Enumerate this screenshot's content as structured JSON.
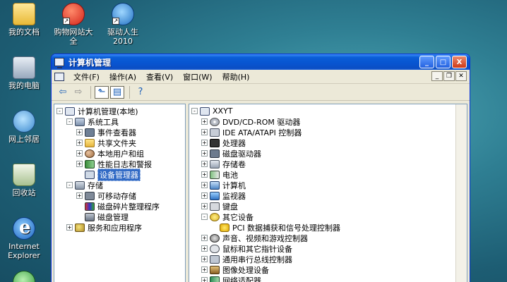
{
  "desktop": {
    "icons": [
      {
        "label": "我的文档",
        "icon": "my-documents-icon"
      },
      {
        "label": "购物网站大全",
        "icon": "shopping-sites-icon",
        "shortcut": true
      },
      {
        "label": "驱动人生2010",
        "icon": "driver-life-icon",
        "shortcut": true
      },
      {
        "label": "我的电脑",
        "icon": "my-computer-icon"
      },
      {
        "label": "网上邻居",
        "icon": "network-places-icon"
      },
      {
        "label": "回收站",
        "icon": "recycle-bin-icon"
      },
      {
        "label": "Internet Explorer",
        "icon": "internet-explorer-icon"
      }
    ]
  },
  "window": {
    "title": "计算机管理",
    "buttons": {
      "minimize": "_",
      "maximize": "□",
      "close": "X"
    },
    "menu": [
      "文件(F)",
      "操作(A)",
      "查看(V)",
      "窗口(W)",
      "帮助(H)"
    ],
    "mdi_buttons": {
      "minimize": "_",
      "restore": "❐",
      "close": "✕"
    }
  },
  "toolbar": {
    "back": "⇦",
    "forward": "⇨",
    "up": "⬑",
    "show_hide": "▤",
    "help": "?"
  },
  "left_tree": [
    {
      "label": "计算机管理(本地)",
      "indent": 0,
      "expander": "-",
      "icon": "computer-management-icon"
    },
    {
      "label": "系统工具",
      "indent": 1,
      "expander": "-",
      "icon": "system-tools-icon"
    },
    {
      "label": "事件查看器",
      "indent": 2,
      "expander": "+",
      "icon": "event-viewer-icon"
    },
    {
      "label": "共享文件夹",
      "indent": 2,
      "expander": "+",
      "icon": "shared-folders-icon"
    },
    {
      "label": "本地用户和组",
      "indent": 2,
      "expander": "+",
      "icon": "local-users-icon"
    },
    {
      "label": "性能日志和警报",
      "indent": 2,
      "expander": "+",
      "icon": "performance-logs-icon"
    },
    {
      "label": "设备管理器",
      "indent": 2,
      "expander": "",
      "icon": "device-manager-icon",
      "selected": true
    },
    {
      "label": "存储",
      "indent": 1,
      "expander": "-",
      "icon": "storage-icon"
    },
    {
      "label": "可移动存储",
      "indent": 2,
      "expander": "+",
      "icon": "removable-storage-icon"
    },
    {
      "label": "磁盘碎片整理程序",
      "indent": 2,
      "expander": "",
      "icon": "defragmenter-icon"
    },
    {
      "label": "磁盘管理",
      "indent": 2,
      "expander": "",
      "icon": "disk-management-icon"
    },
    {
      "label": "服务和应用程序",
      "indent": 1,
      "expander": "+",
      "icon": "services-applications-icon"
    }
  ],
  "right_tree": [
    {
      "label": "XXYT",
      "indent": 0,
      "expander": "-",
      "icon": "computer-icon"
    },
    {
      "label": "DVD/CD-ROM 驱动器",
      "indent": 1,
      "expander": "+",
      "icon": "cdrom-icon"
    },
    {
      "label": "IDE ATA/ATAPI 控制器",
      "indent": 1,
      "expander": "+",
      "icon": "ide-controller-icon"
    },
    {
      "label": "处理器",
      "indent": 1,
      "expander": "+",
      "icon": "processor-icon"
    },
    {
      "label": "磁盘驱动器",
      "indent": 1,
      "expander": "+",
      "icon": "disk-drive-icon"
    },
    {
      "label": "存储卷",
      "indent": 1,
      "expander": "+",
      "icon": "storage-volume-icon"
    },
    {
      "label": "电池",
      "indent": 1,
      "expander": "+",
      "icon": "battery-icon"
    },
    {
      "label": "计算机",
      "indent": 1,
      "expander": "+",
      "icon": "computer-node-icon"
    },
    {
      "label": "监视器",
      "indent": 1,
      "expander": "+",
      "icon": "monitor-icon"
    },
    {
      "label": "键盘",
      "indent": 1,
      "expander": "+",
      "icon": "keyboard-icon"
    },
    {
      "label": "其它设备",
      "indent": 1,
      "expander": "-",
      "icon": "other-devices-icon"
    },
    {
      "label": "PCI 数据捕获和信号处理控制器",
      "indent": 2,
      "expander": "",
      "icon": "unknown-device-warning-icon"
    },
    {
      "label": "声音、视频和游戏控制器",
      "indent": 1,
      "expander": "+",
      "icon": "sound-video-icon"
    },
    {
      "label": "鼠标和其它指针设备",
      "indent": 1,
      "expander": "+",
      "icon": "mouse-icon"
    },
    {
      "label": "通用串行总线控制器",
      "indent": 1,
      "expander": "+",
      "icon": "usb-controller-icon"
    },
    {
      "label": "图像处理设备",
      "indent": 1,
      "expander": "+",
      "icon": "imaging-device-icon"
    },
    {
      "label": "网络适配器",
      "indent": 1,
      "expander": "+",
      "icon": "network-adapter-icon"
    }
  ]
}
